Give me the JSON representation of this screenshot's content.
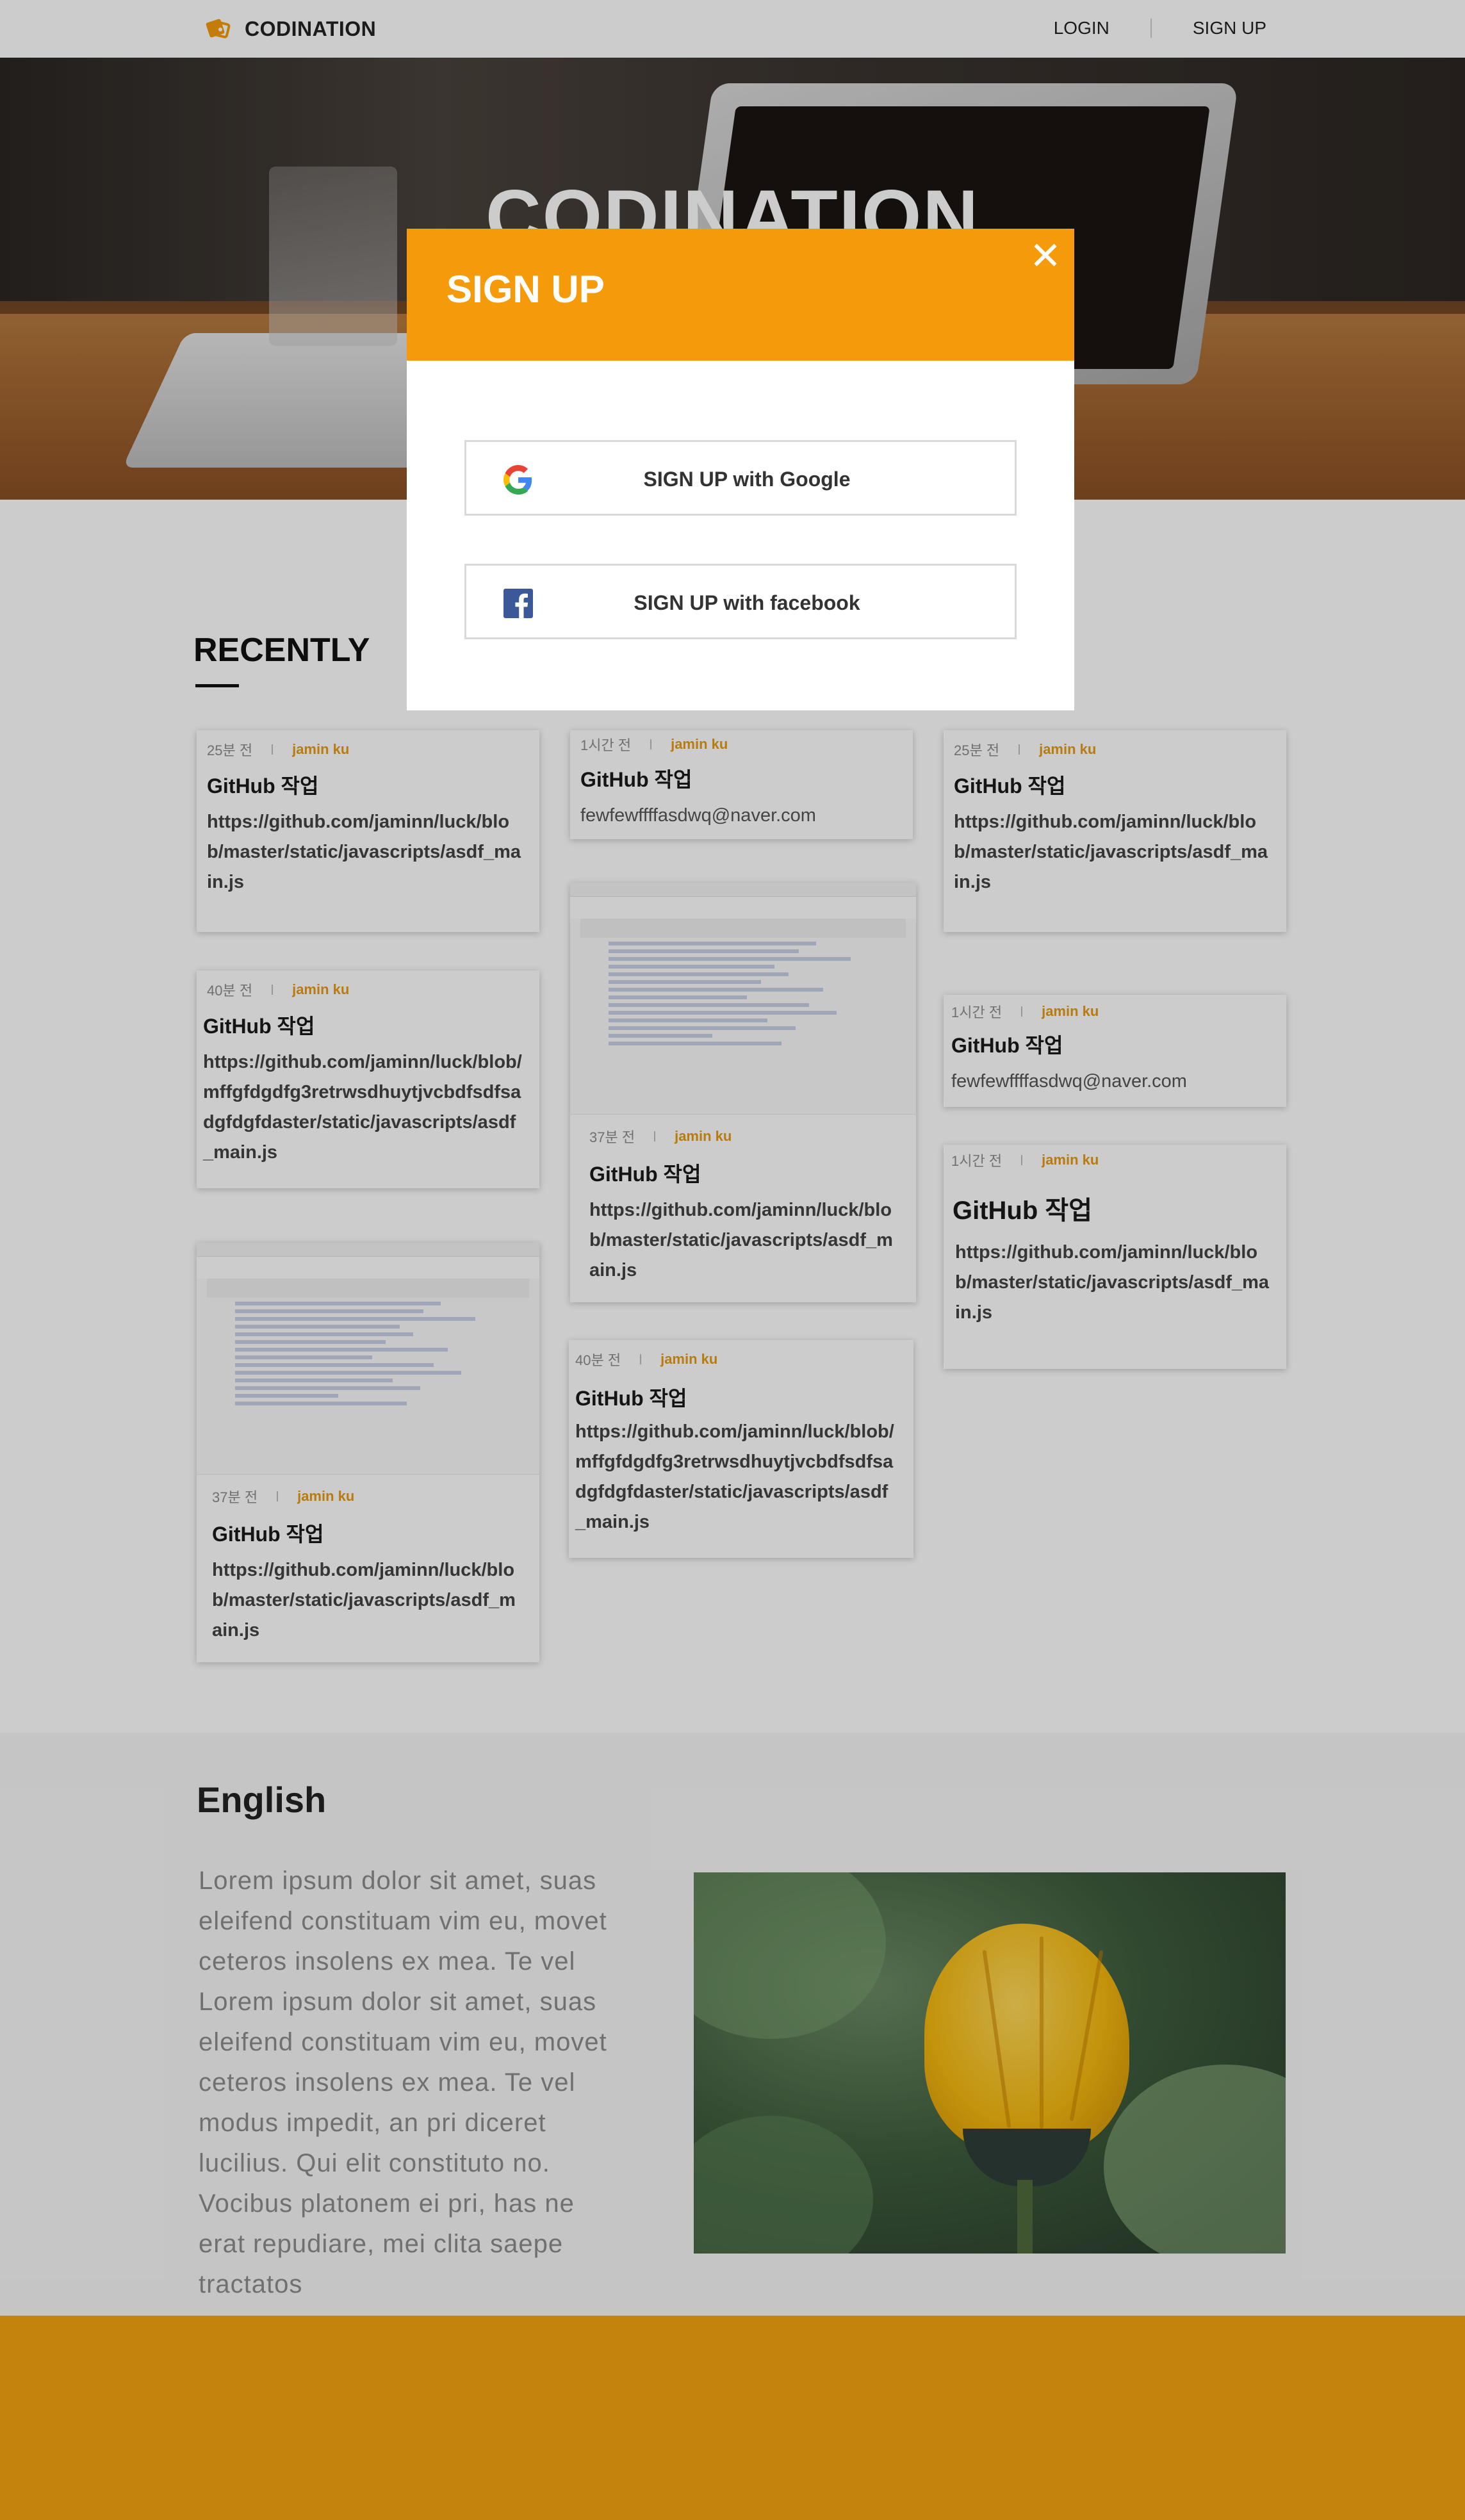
{
  "header": {
    "brand": "CODINATION",
    "nav": {
      "login": "LOGIN",
      "signup": "SIGN UP"
    }
  },
  "hero": {
    "title": "CODINATION"
  },
  "recently": {
    "title": "RECENTLY",
    "cards": [
      {
        "time": "25분 전",
        "author": "jamin ku",
        "title": "GitHub 작업",
        "body": "https://github.com/jaminn/luck/blob/master/static/javascripts/asdf_main.js"
      },
      {
        "time": "40분 전",
        "author": "jamin ku",
        "title": "GitHub 작업",
        "body": "https://github.com/jaminn/luck/blob/mffgfdgdfg3retrwsdhuytjvcbdfsdfsadgfdgfdaster/static/javascripts/asdf_main.js"
      },
      {
        "time": "37분 전",
        "author": "jamin ku",
        "title": "GitHub 작업",
        "body": "https://github.com/jaminn/luck/blob/master/static/javascripts/asdf_main.js"
      },
      {
        "time": "1시간 전",
        "author": "jamin ku",
        "title": "GitHub 작업",
        "body": "fewfewffffasdwq@naver.com"
      },
      {
        "time": "37분 전",
        "author": "jamin ku",
        "title": "GitHub 작업",
        "body": "https://github.com/jaminn/luck/blob/master/static/javascripts/asdf_main.js"
      },
      {
        "time": "40분 전",
        "author": "jamin ku",
        "title": "GitHub 작업",
        "body": "https://github.com/jaminn/luck/blob/mffgfdgdfg3retrwsdhuytjvcbdfsdfsadgfdgfdaster/static/javascripts/asdf_main.js"
      },
      {
        "time": "25분 전",
        "author": "jamin ku",
        "title": "GitHub 작업",
        "body": "https://github.com/jaminn/luck/blob/master/static/javascripts/asdf_main.js"
      },
      {
        "time": "1시간 전",
        "author": "jamin ku",
        "title": "GitHub 작업",
        "body": "fewfewffffasdwq@naver.com"
      },
      {
        "time": "1시간 전",
        "author": "jamin ku",
        "title": "GitHub 작업",
        "body": "https://github.com/jaminn/luck/blob/master/static/javascripts/asdf_main.js"
      }
    ]
  },
  "english": {
    "title": "English",
    "text": "Lorem ipsum dolor sit amet, suas eleifend constituam vim eu, movet ceteros insolens ex mea. Te vel Lorem ipsum dolor sit amet, suas eleifend constituam vim eu, movet ceteros insolens ex mea. Te vel modus impedit, an pri diceret lucilius. Qui elit constituto no. Vocibus platonem ei pri, has ne erat repudiare, mei clita saepe tractatos"
  },
  "modal": {
    "title": "SIGN UP",
    "google_label": "SIGN UP with Google",
    "facebook_label": "SIGN UP with facebook"
  },
  "icons": {
    "logo": "codination-logo-icon",
    "close": "close-icon",
    "google": "google-icon",
    "facebook": "facebook-icon"
  },
  "colors": {
    "accent": "#f59b0b",
    "author": "#e89a13",
    "footer": "#f5a40f",
    "facebook": "#3b5998"
  }
}
